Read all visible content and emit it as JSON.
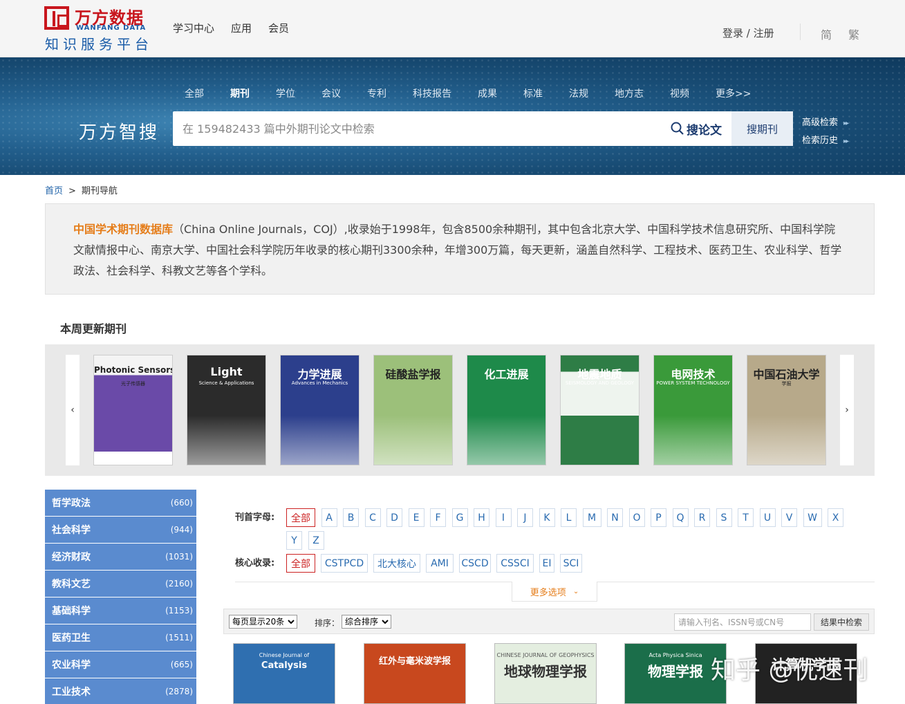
{
  "logo": {
    "cn": "万方数据",
    "en": "WANFANG DATA",
    "sub": "知识服务平台"
  },
  "topnav": [
    "学习中心",
    "应用",
    "会员"
  ],
  "login": "登录 / 注册",
  "lang": [
    "简",
    "繁"
  ],
  "banner": {
    "categories": [
      "全部",
      "期刊",
      "学位",
      "会议",
      "专利",
      "科技报告",
      "成果",
      "标准",
      "法规",
      "地方志",
      "视频",
      "更多>>"
    ],
    "active_category": "期刊",
    "brand": "万方智搜",
    "search_placeholder": "在 159482433 篇中外期刊论文中检索",
    "btn_paper": "搜论文",
    "btn_journal": "搜期刊",
    "advanced": "高级检索",
    "history": "检索历史"
  },
  "breadcrumb": {
    "home": "首页",
    "sep": ">",
    "current": "期刊导航"
  },
  "intro": {
    "highlight": "中国学术期刊数据库",
    "text": "（China Online Journals，COJ）,收录始于1998年，包含8500余种期刊，其中包含北京大学、中国科学技术信息研究所、中国科学院文献情报中心、南京大学、中国社会科学院历年收录的核心期刊3300余种，年增300万篇，每天更新，涵盖自然科学、工程技术、医药卫生、农业科学、哲学政法、社会科学、科教文艺等各个学科。"
  },
  "weekly": {
    "title": "本周更新期刊",
    "prev": "‹",
    "next": "›",
    "covers": [
      {
        "title": "Photonic Sensors",
        "sub": "光子传感器",
        "color": "#6a4aa8"
      },
      {
        "title": "Light",
        "sub": "Science & Applications",
        "color": "#2b2b2b"
      },
      {
        "title": "力学进展",
        "sub": "Advances in Mechanics",
        "color": "#2c3f8c"
      },
      {
        "title": "硅酸盐学报",
        "sub": "",
        "color": "#9cc07a"
      },
      {
        "title": "化工进展",
        "sub": "",
        "color": "#1e8a4a"
      },
      {
        "title": "地震地质",
        "sub": "SEISMOLOGY AND GEOLOGY",
        "color": "#2e7d46"
      },
      {
        "title": "电网技术",
        "sub": "POWER SYSTEM TECHNOLOGY",
        "color": "#3a9a3a"
      },
      {
        "title": "中国石油大学",
        "sub": "学报",
        "color": "#b7a98a"
      }
    ]
  },
  "sidebar": [
    {
      "name": "哲学政法",
      "count": "(660)"
    },
    {
      "name": "社会科学",
      "count": "(944)"
    },
    {
      "name": "经济财政",
      "count": "(1031)"
    },
    {
      "name": "教科文艺",
      "count": "(2160)"
    },
    {
      "name": "基础科学",
      "count": "(1153)"
    },
    {
      "name": "医药卫生",
      "count": "(1511)"
    },
    {
      "name": "农业科学",
      "count": "(665)"
    },
    {
      "name": "工业技术",
      "count": "(2878)"
    }
  ],
  "filters": {
    "letter_label": "刊首字母:",
    "letters": [
      "全部",
      "A",
      "B",
      "C",
      "D",
      "E",
      "F",
      "G",
      "H",
      "I",
      "J",
      "K",
      "L",
      "M",
      "N",
      "O",
      "P",
      "Q",
      "R",
      "S",
      "T",
      "U",
      "V",
      "W",
      "X",
      "Y",
      "Z"
    ],
    "core_label": "核心收录:",
    "cores": [
      "全部",
      "CSTPCD",
      "北大核心",
      "AMI",
      "CSCD",
      "CSSCI",
      "EI",
      "SCI"
    ],
    "more": "更多选项"
  },
  "toolbar": {
    "per_page": "每页显示20条",
    "sort_label": "排序：",
    "sort": "综合排序",
    "search_placeholder": "请输入刊名、ISSN号或CN号",
    "search_btn": "结果中检索"
  },
  "results": [
    {
      "title": "Catalysis",
      "sub": "Chinese Journal of",
      "color": "#2f6fb0"
    },
    {
      "title": "红外与毫米波学报",
      "sub": "",
      "color": "#c8481e"
    },
    {
      "title": "地球物理学报",
      "sub": "CHINESE JOURNAL OF GEOPHYSICS",
      "color": "#e4eee0"
    },
    {
      "title": "物理学报",
      "sub": "Acta Physica Sinica",
      "color": "#1b6e4a"
    },
    {
      "title": "计算机学报",
      "sub": "",
      "color": "#222222"
    }
  ],
  "watermark": "知乎 @优速刊",
  "colors": {
    "brand_red": "#c8161d",
    "brand_blue": "#1a5ca8",
    "sidebar_blue": "#5a8bcf",
    "highlight_orange": "#e57d1a"
  }
}
